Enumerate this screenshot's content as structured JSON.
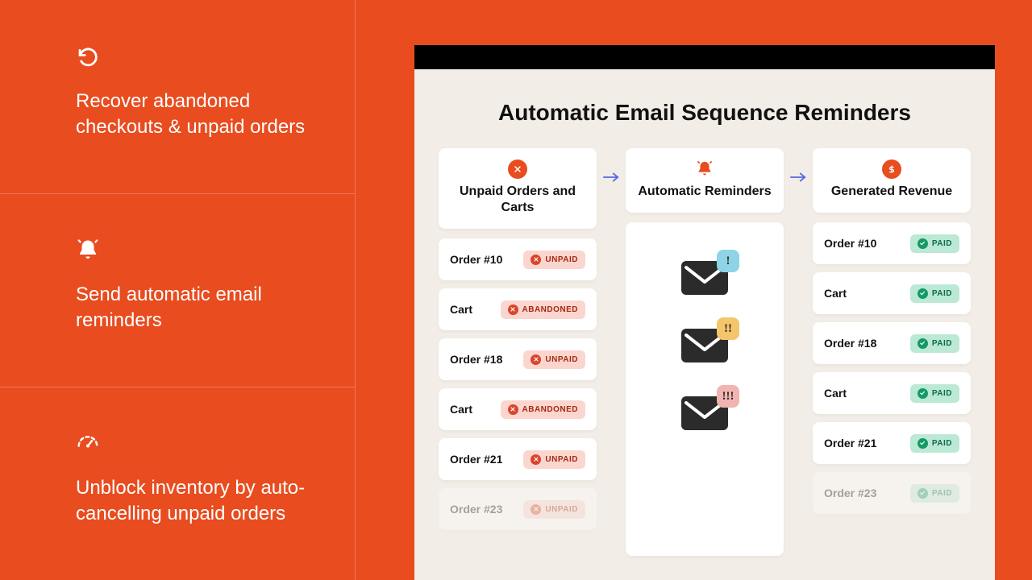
{
  "colors": {
    "brand": "#e84c1f",
    "badge_unpaid_bg": "#fbd6cf",
    "badge_paid_bg": "#bce8d6"
  },
  "features": [
    {
      "icon": "undo-icon",
      "text": "Recover abandoned checkouts & unpaid orders"
    },
    {
      "icon": "bell-icon",
      "text": "Send automatic email reminders"
    },
    {
      "icon": "gauge-icon",
      "text": "Unblock inventory by auto-cancelling unpaid orders"
    }
  ],
  "panel": {
    "title": "Automatic Email Sequence Reminders",
    "columns": {
      "unpaid": {
        "icon": "x-circle-icon",
        "title": "Unpaid Orders and Carts"
      },
      "reminders": {
        "icon": "bell-icon",
        "title": "Automatic Reminders"
      },
      "revenue": {
        "icon": "dollar-circle-icon",
        "title": "Generated Revenue"
      }
    },
    "badges": {
      "unpaid": "UNPAID",
      "abandoned": "ABANDONED",
      "paid": "PAID"
    },
    "unpaid_rows": [
      {
        "label": "Order #10",
        "status": "unpaid"
      },
      {
        "label": "Cart",
        "status": "abandoned"
      },
      {
        "label": "Order #18",
        "status": "unpaid"
      },
      {
        "label": "Cart",
        "status": "abandoned"
      },
      {
        "label": "Order #21",
        "status": "unpaid"
      },
      {
        "label": "Order #23",
        "status": "unpaid",
        "faded": true
      }
    ],
    "reminder_emails": [
      {
        "bangs": "!",
        "color": "c1"
      },
      {
        "bangs": "!!",
        "color": "c2"
      },
      {
        "bangs": "!!!",
        "color": "c3"
      }
    ],
    "revenue_rows": [
      {
        "label": "Order #10",
        "status": "paid"
      },
      {
        "label": "Cart",
        "status": "paid"
      },
      {
        "label": "Order #18",
        "status": "paid"
      },
      {
        "label": "Cart",
        "status": "paid"
      },
      {
        "label": "Order #21",
        "status": "paid"
      },
      {
        "label": "Order #23",
        "status": "paid",
        "faded": true
      }
    ]
  }
}
